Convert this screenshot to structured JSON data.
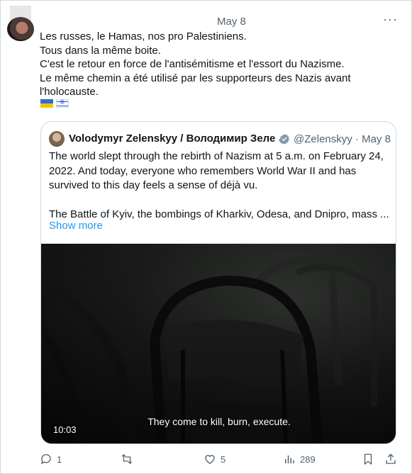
{
  "tweet": {
    "date": "May 8",
    "more_label": "···",
    "lines": [
      "Les russes, le Hamas, nos pro Palestiniens.",
      "Tous dans la même boite.",
      "C'est le retour en force de l'antisémitisme et l'essort du Nazisme.",
      "Le même chemin a été utilisé par les supporteurs des Nazis avant",
      "l'holocauste."
    ],
    "flags": [
      "ukraine-flag",
      "israel-flag"
    ]
  },
  "quote": {
    "name": "Volodymyr Zelenskyy / Володимир Зелен",
    "handle_date": "@Zelenskyy · May 8",
    "verified_color": "#829aab",
    "paragraph1": [
      "The world slept through the rebirth of Nazism at 5 a.m. on February 24,",
      "2022. And today, everyone who remembers World War II and has",
      "survived to this day feels a sense of déjà vu."
    ],
    "paragraph2": "The Battle of Kyiv, the bombings of Kharkiv, Odesa, and Dnipro, mass ...",
    "show_more": "Show more",
    "video": {
      "subtitle": "They come to kill, burn, execute.",
      "duration": "10:03"
    }
  },
  "actions": {
    "replies": "1",
    "retweets": "",
    "likes": "5",
    "views": "289"
  },
  "colors": {
    "accent": "#1d9bf0",
    "muted": "#536471"
  }
}
